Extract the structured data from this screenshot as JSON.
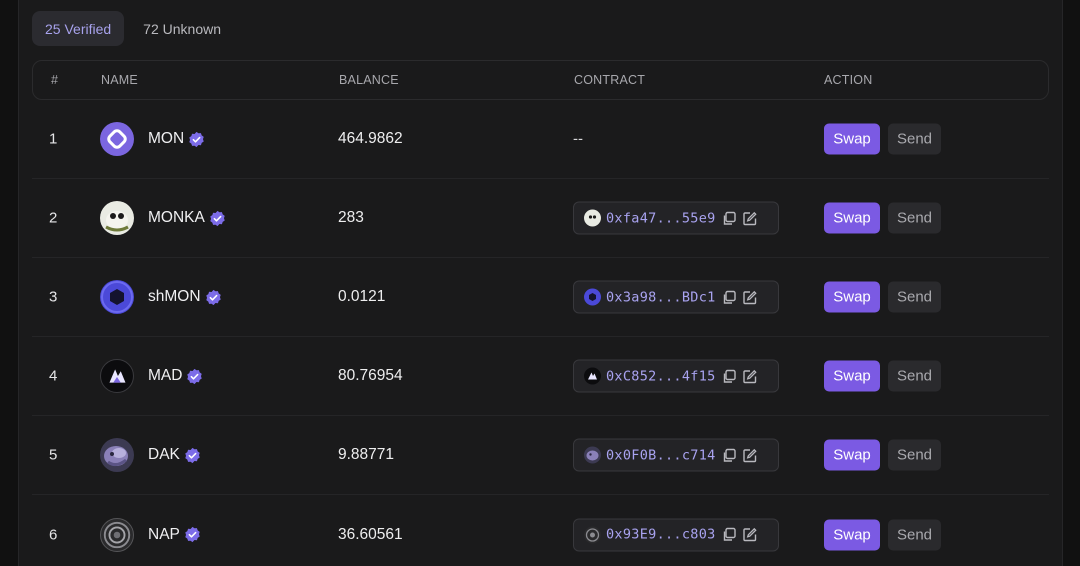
{
  "tabs": [
    {
      "label": "25 Verified",
      "active": true
    },
    {
      "label": "72 Unknown",
      "active": false
    }
  ],
  "columns": {
    "index": "#",
    "name": "NAME",
    "balance": "BALANCE",
    "contract": "CONTRACT",
    "action": "ACTION"
  },
  "actions": {
    "swap_label": "Swap",
    "send_label": "Send"
  },
  "colors": {
    "accent": "#7b5ae3",
    "verified": "#7c6ce8",
    "address": "#a9a3f0"
  },
  "tokens": [
    {
      "index": "1",
      "name": "MON",
      "balance": "464.9862",
      "contract": "--",
      "icon": "mon-logo-icon"
    },
    {
      "index": "2",
      "name": "MONKA",
      "balance": "283",
      "contract": "0xfa47...55e9",
      "icon": "monka-logo-icon"
    },
    {
      "index": "3",
      "name": "shMON",
      "balance": "0.0121",
      "contract": "0x3a98...BDc1",
      "icon": "shmon-logo-icon"
    },
    {
      "index": "4",
      "name": "MAD",
      "balance": "80.76954",
      "contract": "0xC852...4f15",
      "icon": "mad-logo-icon"
    },
    {
      "index": "5",
      "name": "DAK",
      "balance": "9.88771",
      "contract": "0x0F0B...c714",
      "icon": "dak-logo-icon"
    },
    {
      "index": "6",
      "name": "NAP",
      "balance": "36.60561",
      "contract": "0x93E9...c803",
      "icon": "nap-logo-icon"
    }
  ]
}
